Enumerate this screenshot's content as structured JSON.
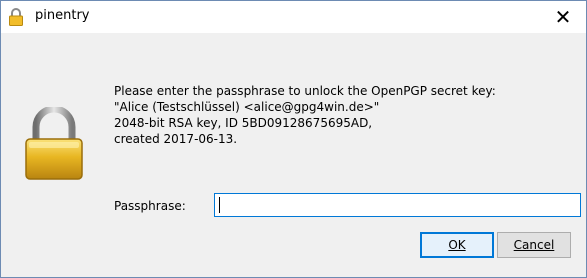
{
  "window": {
    "title": "pinentry",
    "close_glyph": "✕"
  },
  "prompt": {
    "lines": [
      "Please enter the passphrase to unlock the OpenPGP secret key:",
      "\"Alice (Testschlüssel) <alice@gpg4win.de>\"",
      "2048-bit RSA key, ID 5BD09128675695AD,",
      "created 2017-06-13."
    ]
  },
  "passphrase": {
    "label": "Passphrase:",
    "value": ""
  },
  "buttons": {
    "ok": "OK",
    "cancel": "Cancel"
  },
  "icons": {
    "title_icon": "lock-icon",
    "dialog_icon": "lock-icon",
    "lock_color": "#e3b21c"
  }
}
